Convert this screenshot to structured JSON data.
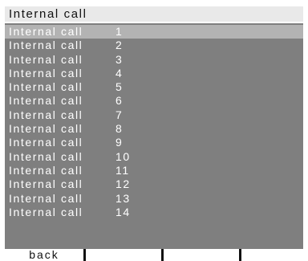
{
  "title": "Internal call",
  "selected_index": 0,
  "items": [
    {
      "label": "Internal call",
      "number": "1"
    },
    {
      "label": "Internal call",
      "number": "2"
    },
    {
      "label": "Internal call",
      "number": "3"
    },
    {
      "label": "Internal call",
      "number": "4"
    },
    {
      "label": "Internal call",
      "number": "5"
    },
    {
      "label": "Internal call",
      "number": "6"
    },
    {
      "label": "Internal call",
      "number": "7"
    },
    {
      "label": "Internal call",
      "number": "8"
    },
    {
      "label": "Internal call",
      "number": "9"
    },
    {
      "label": "Internal call",
      "number": "10"
    },
    {
      "label": "Internal call",
      "number": "11"
    },
    {
      "label": "Internal call",
      "number": "12"
    },
    {
      "label": "Internal call",
      "number": "13"
    },
    {
      "label": "Internal call",
      "number": "14"
    }
  ],
  "softkeys": [
    "back",
    "",
    "",
    ""
  ],
  "colors": {
    "screen_background": "#7f7f7f",
    "title_background": "#e9e9e9",
    "selection_highlight": "#b3b3b3",
    "item_text": "#ffffff",
    "softkey_background": "#ffffff"
  }
}
